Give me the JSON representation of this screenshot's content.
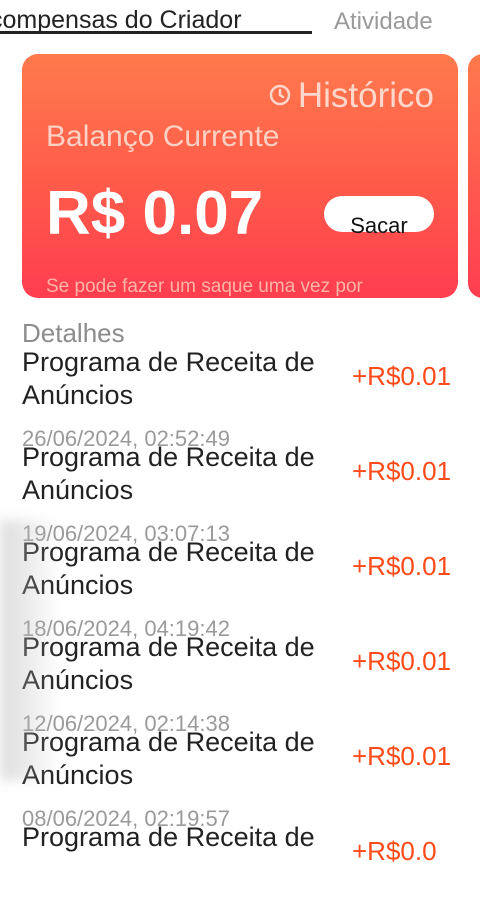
{
  "tabs": {
    "active": "compensas do Criador",
    "inactive": "Atividade"
  },
  "card": {
    "history_label": "Histórico",
    "balance_label": "Balanço Currente",
    "amount": "R$ 0.07",
    "withdraw_label": "Sacar",
    "note": "Se pode fazer um saque uma vez por"
  },
  "details": {
    "label": "Detalhes",
    "items": [
      {
        "title": "Programa de Receita de Anúncios",
        "amount": "+R$0.01",
        "date": "26/06/2024, 02:52:49"
      },
      {
        "title": "Programa de Receita de Anúncios",
        "amount": "+R$0.01",
        "date": "19/06/2024, 03:07:13"
      },
      {
        "title": "Programa de Receita de Anúncios",
        "amount": "+R$0.01",
        "date": "18/06/2024, 04:19:42"
      },
      {
        "title": "Programa de Receita de Anúncios",
        "amount": "+R$0.01",
        "date": "12/06/2024, 02:14:38"
      },
      {
        "title": "Programa de Receita de Anúncios",
        "amount": "+R$0.01",
        "date": "08/06/2024, 02:19:57"
      },
      {
        "title": "Programa de Receita de",
        "amount": "+R$0.0",
        "date": ""
      }
    ]
  },
  "colors": {
    "accent": "#ff4a1a",
    "card_top": "#ff7a4d",
    "card_bottom": "#ff3d50"
  }
}
